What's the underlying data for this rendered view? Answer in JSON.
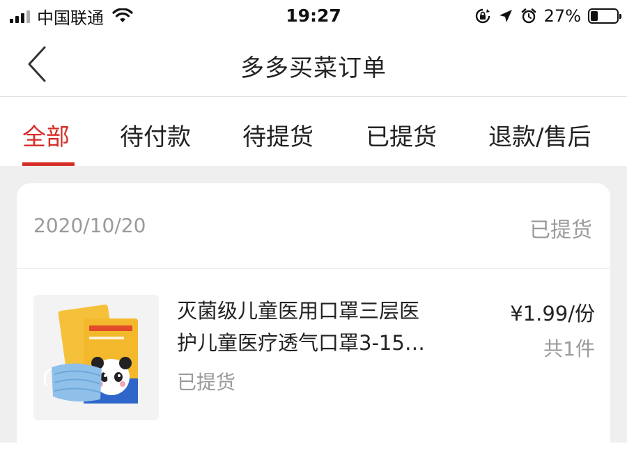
{
  "status_bar": {
    "carrier": "中国联通",
    "time": "19:27",
    "battery_percent": "27%",
    "battery_level": 0.27
  },
  "nav": {
    "title": "多多买菜订单",
    "back_icon": "chevron-left-icon"
  },
  "tabs": [
    {
      "label": "全部",
      "active": true
    },
    {
      "label": "待付款",
      "active": false
    },
    {
      "label": "待提货",
      "active": false
    },
    {
      "label": "已提货",
      "active": false
    },
    {
      "label": "退款/售后",
      "active": false
    }
  ],
  "accent_color": "#d62d27",
  "order": {
    "date": "2020/10/20",
    "status": "已提货",
    "item": {
      "title_line1": "灭菌级儿童医用口罩三层医",
      "title_line2": "护儿童医疗透气口罩3-15…",
      "state": "已提货",
      "price": "¥1.99/份",
      "quantity": "共1件"
    }
  }
}
